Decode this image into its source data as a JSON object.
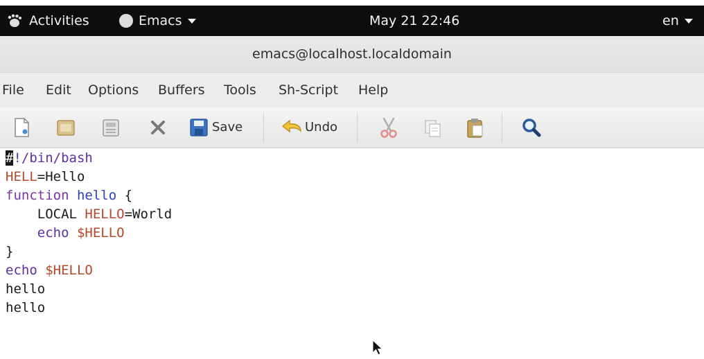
{
  "topbar": {
    "activities": "Activities",
    "app_name": "Emacs",
    "clock": "May 21 22:46",
    "language": "en"
  },
  "window": {
    "title": "emacs@localhost.localdomain"
  },
  "menubar": {
    "items": [
      "File",
      "Edit",
      "Options",
      "Buffers",
      "Tools",
      "Sh-Script",
      "Help"
    ]
  },
  "toolbar": {
    "save_label": "Save",
    "undo_label": "Undo",
    "icons": [
      "new-file-icon",
      "open-folder-icon",
      "dired-icon",
      "close-buffer-icon",
      "save-icon",
      "undo-icon",
      "cut-icon",
      "copy-icon",
      "paste-icon",
      "search-icon"
    ]
  },
  "editor": {
    "cursor_char": "#",
    "lines": [
      "#!/bin/bash",
      "HELL=Hello",
      "function hello {",
      "    LOCAL HELLO=World",
      "    echo $HELLO",
      "}",
      "echo $HELLO",
      "hello",
      "hello"
    ],
    "tokens": {
      "line0_rest": "!/bin/bash",
      "line1_var": "HELL",
      "line1_rest": "=Hello",
      "line2_kw": "function",
      "line2_fn": "hello",
      "line2_rest": " {",
      "line3_indent_cmd": "    LOCAL ",
      "line3_var": "HELLO",
      "line3_rest": "=World",
      "line4_builtin": "    echo ",
      "line4_var": "$HELLO",
      "line5": "}",
      "line6_builtin": "echo ",
      "line6_var": "$HELLO",
      "line7": "hello",
      "line8": "hello"
    }
  }
}
